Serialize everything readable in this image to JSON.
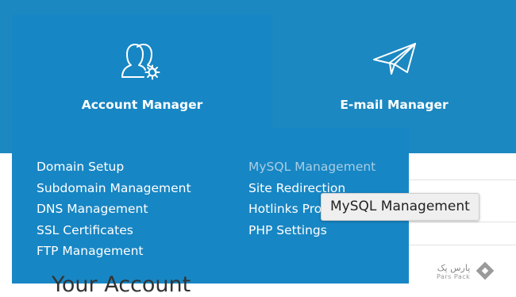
{
  "tiles": {
    "account": {
      "label": "Account Manager",
      "icon": "users-gear-icon"
    },
    "email": {
      "label": "E-mail Manager",
      "icon": "paper-plane-icon"
    }
  },
  "menu": {
    "left": [
      "Domain Setup",
      "Subdomain Management",
      "DNS Management",
      "SSL Certificates",
      "FTP Management"
    ],
    "right": [
      "MySQL Management",
      "Site Redirection",
      "Hotlinks Pro",
      "PHP Settings"
    ]
  },
  "tooltip": "MySQL Management",
  "page": {
    "heading": "Your Account"
  },
  "brand": {
    "name_fa": "پارس پک",
    "name_en": "Pars Pack",
    "icon": "diamond-logo-icon"
  },
  "colors": {
    "topbar": "#1c88c1",
    "tile_active": "#1786c4",
    "menu_hover": "#a7cde5"
  }
}
